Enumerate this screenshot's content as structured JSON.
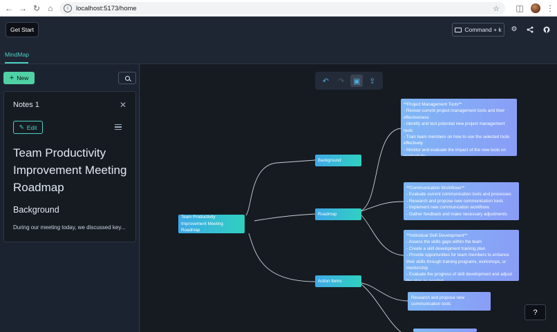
{
  "browser": {
    "url": "localhost:5173/home"
  },
  "header": {
    "get_start_label": "Get Start",
    "command_label": "Command + k"
  },
  "tabs": [
    {
      "label": "MindMap"
    }
  ],
  "sidebar": {
    "new_label": "New",
    "note": {
      "title": "Notes 1",
      "edit_label": "Edit",
      "heading": "Team Productivity Improvement Meeting Roadmap",
      "subheading": "Background",
      "body": "During our meeting today, we discussed key..."
    }
  },
  "mindmap": {
    "root": "Team Productivity Improvement Meeting Roadmap",
    "branches": {
      "background": "Background",
      "roadmap": "Roadmap",
      "action_items": "Action Items"
    },
    "leaves": {
      "pm_tools": "**Project Management Tools**\n- Review current project management tools and their effectiveness\n- Identify and test potential new project management tools\n- Train team members on how to use the selected tools effectively\n- Monitor and evaluate the impact of the new tools on productivity",
      "comm_workflows": "**Communication Workflows**\n- Evaluate current communication tools and processes\n- Research and propose new communication tools\n- Implement new communication workflows\n- Gather feedback and make necessary adjustments",
      "skill_dev": "**Individual Skill Development**\n- Assess the skills gaps within the team\n- Create a skill development training plan\n- Provide opportunities for team members to enhance their skills through training programs, workshops, or mentorship\n- Evaluate the progress of skill development and adjust the plan as needed",
      "action_1": "Research and propose new communication tools",
      "action_2": ""
    }
  },
  "help_label": "?"
}
